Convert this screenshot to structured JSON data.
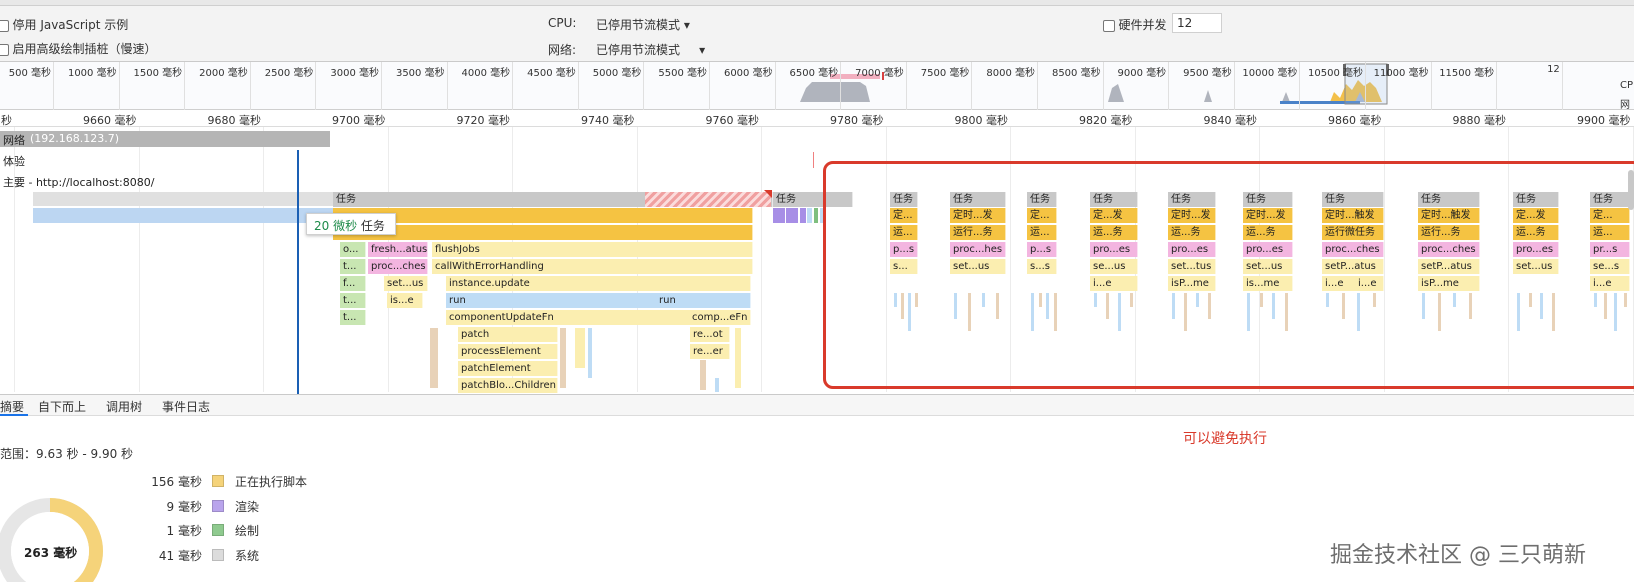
{
  "settings": {
    "disable_js_samples": "停用 JavaScript 示例",
    "enable_paint_instrumentation": "启用高级绘制插桩（慢速）",
    "cpu_label": "CPU:",
    "cpu_value": "已停用节流模式",
    "network_label": "网络:",
    "network_value": "已停用节流模式",
    "hardware_concurrency_label": "硬件并发",
    "hardware_concurrency_value": "12"
  },
  "overview_ticks": [
    "500 毫秒",
    "1000 毫秒",
    "1500 毫秒",
    "2000 毫秒",
    "2500 毫秒",
    "3000 毫秒",
    "3500 毫秒",
    "4000 毫秒",
    "4500 毫秒",
    "5000 毫秒",
    "5500 毫秒",
    "6000 毫秒",
    "6500 毫秒",
    "7000 毫秒",
    "7500 毫秒",
    "8000 毫秒",
    "8500 毫秒",
    "9000 毫秒",
    "9500 毫秒",
    "10000 毫秒",
    "10500 毫秒",
    "11000 毫秒",
    "11500 毫秒",
    "12"
  ],
  "overview_side": [
    "CP",
    "网"
  ],
  "ruler_ticks": [
    "秒",
    "9660 毫秒",
    "9680 毫秒",
    "9700 毫秒",
    "9720 毫秒",
    "9740 毫秒",
    "9760 毫秒",
    "9780 毫秒",
    "9800 毫秒",
    "9820 毫秒",
    "9840 毫秒",
    "9860 毫秒",
    "9880 毫秒",
    "9900 毫秒"
  ],
  "tracks": {
    "network": "网络",
    "network_host": "(192.168.123.7)",
    "experience": "体验",
    "main": "主要 - http://localhost:8080/"
  },
  "tooltip": {
    "duration": "20 微秒",
    "name": "任务"
  },
  "flame": {
    "task": "任务",
    "flushJobs": "flushJobs",
    "callWithErrorHandling": "callWithErrorHandling",
    "instance_update": "instance.update",
    "run": "run",
    "run2": "run",
    "componentUpdateFn": "componentUpdateFn",
    "patch": "patch",
    "processElement": "processElement",
    "patchElement": "patchElement",
    "patchBlockChildren": "patchBlo...Children",
    "patch2": "patch",
    "o": "o...",
    "t1": "t...",
    "f": "f...",
    "t2": "t...",
    "t3": "t...",
    "freshStatus": "fresh...atus",
    "procChes": "proc...ches",
    "setUs": "set...us",
    "isE": "is...e",
    "compEFn": "comp...eFn",
    "reOt": "re...ot",
    "reEr": "re...er"
  },
  "flame_groups": [
    {
      "task": "任务",
      "l1": "定...",
      "l2": "运...",
      "l3": "p...s",
      "l4": "s..."
    },
    {
      "task": "任务",
      "l1": "定时...发",
      "l2": "运行...务",
      "l3": "proc...hes",
      "l4": "set...us"
    },
    {
      "task": "任务",
      "l1": "定...",
      "l2": "运...",
      "l3": "p...s",
      "l4": "s...s"
    },
    {
      "task": "任务",
      "l1": "定...发",
      "l2": "运...务",
      "l3": "pro...es",
      "l4": "se...us",
      "l5": "i...e"
    },
    {
      "task": "任务",
      "l1": "定时...发",
      "l2": "运...务",
      "l3": "pro...es",
      "l4": "set...tus",
      "l5": "isP...me"
    },
    {
      "task": "任务",
      "l1": "定时...发",
      "l2": "运...务",
      "l3": "pro...es",
      "l4": "set...us",
      "l5": "is...me"
    },
    {
      "task": "任务",
      "l1": "定时...触发",
      "l2": "运行微任务",
      "l3": "proc...ches",
      "l4": "setP...atus",
      "l5": "i...e",
      "l6": "i...e"
    },
    {
      "task": "任务",
      "l1": "定时...触发",
      "l2": "运行...务",
      "l3": "proc...ches",
      "l4": "setP...atus",
      "l5": "isP...me"
    },
    {
      "task": "任务",
      "l1": "定...发",
      "l2": "运...务",
      "l3": "pro...es",
      "l4": "set...us"
    },
    {
      "task": "任务",
      "l1": "定...",
      "l2": "运...",
      "l3": "pr...s",
      "l4": "se...s",
      "l5": "i...e"
    }
  ],
  "annotation": "可以避免执行",
  "tabs": [
    "摘要",
    "自下而上",
    "调用树",
    "事件日志"
  ],
  "summary": {
    "range": "范围：9.63 秒 - 9.90 秒",
    "total": "263 毫秒",
    "legend": [
      {
        "value": "156 毫秒",
        "label": "正在执行脚本",
        "color": "#f5d37a"
      },
      {
        "value": "9 毫秒",
        "label": "渲染",
        "color": "#b9a4ec"
      },
      {
        "value": "1 毫秒",
        "label": "绘制",
        "color": "#8fca8f"
      },
      {
        "value": "41 毫秒",
        "label": "系统",
        "color": "#dcdcdc"
      }
    ]
  },
  "watermark": "掘金技术社区 @ 三只萌新",
  "colors": {
    "annotation": "#d93a2b",
    "playhead": "#1a5fb4",
    "scripting": "#f5c342"
  }
}
